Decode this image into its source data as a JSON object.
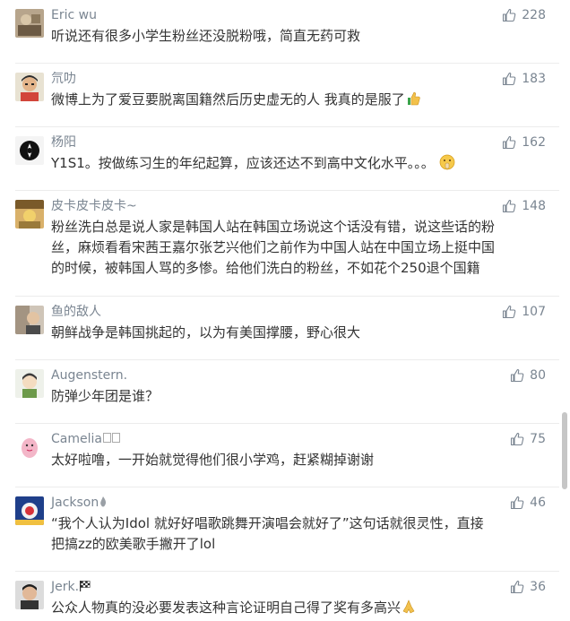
{
  "comments": [
    {
      "username": "Eric wu",
      "likes": "228",
      "text": "听说还有很多小学生粉丝还没脱粉哦，简直无药可救"
    },
    {
      "username": "氘叻",
      "likes": "183",
      "text": "微博上为了爱豆要脱离国籍然后历史虚无的人 我真的是服了"
    },
    {
      "username": "杨阳",
      "likes": "162",
      "text": "Y1S1。按做练习生的年纪起算，应该还达不到高中文化水平。。。"
    },
    {
      "username": "皮卡皮卡皮卡~",
      "likes": "148",
      "text_lines": [
        "粉丝洗白总是说人家是韩国人站在韩国立场说这个话没有错，说这些话的粉",
        "丝，麻烦看看宋茜王嘉尔张艺兴他们之前作为中国人站在中国立场上挺中国",
        "的时候，被韩国人骂的多惨。给他们洗白的粉丝，不如花个250退个国籍"
      ]
    },
    {
      "username": "鱼的敌人",
      "likes": "107",
      "text": "朝鲜战争是韩国挑起的，以为有美国撑腰，野心很大"
    },
    {
      "username": "Augenstern.",
      "likes": "80",
      "text": "防弹少年团是谁？"
    },
    {
      "username": "Camelia",
      "likes": "75",
      "text": "太好啦噜，一开始就觉得他们很小学鸡，赶紧糊掉谢谢"
    },
    {
      "username": "Jackson",
      "likes": "46",
      "text_lines": [
        "“我个人认为Idol 就好好唱歌跳舞开演唱会就好了”这句话就很灵性，直接",
        "把搞zz的欧美歌手撇开了lol"
      ]
    },
    {
      "username": "Jerk.",
      "likes": "36",
      "text": "公众人物真的没必要发表这种言论证明自己得了奖有多高兴"
    }
  ]
}
